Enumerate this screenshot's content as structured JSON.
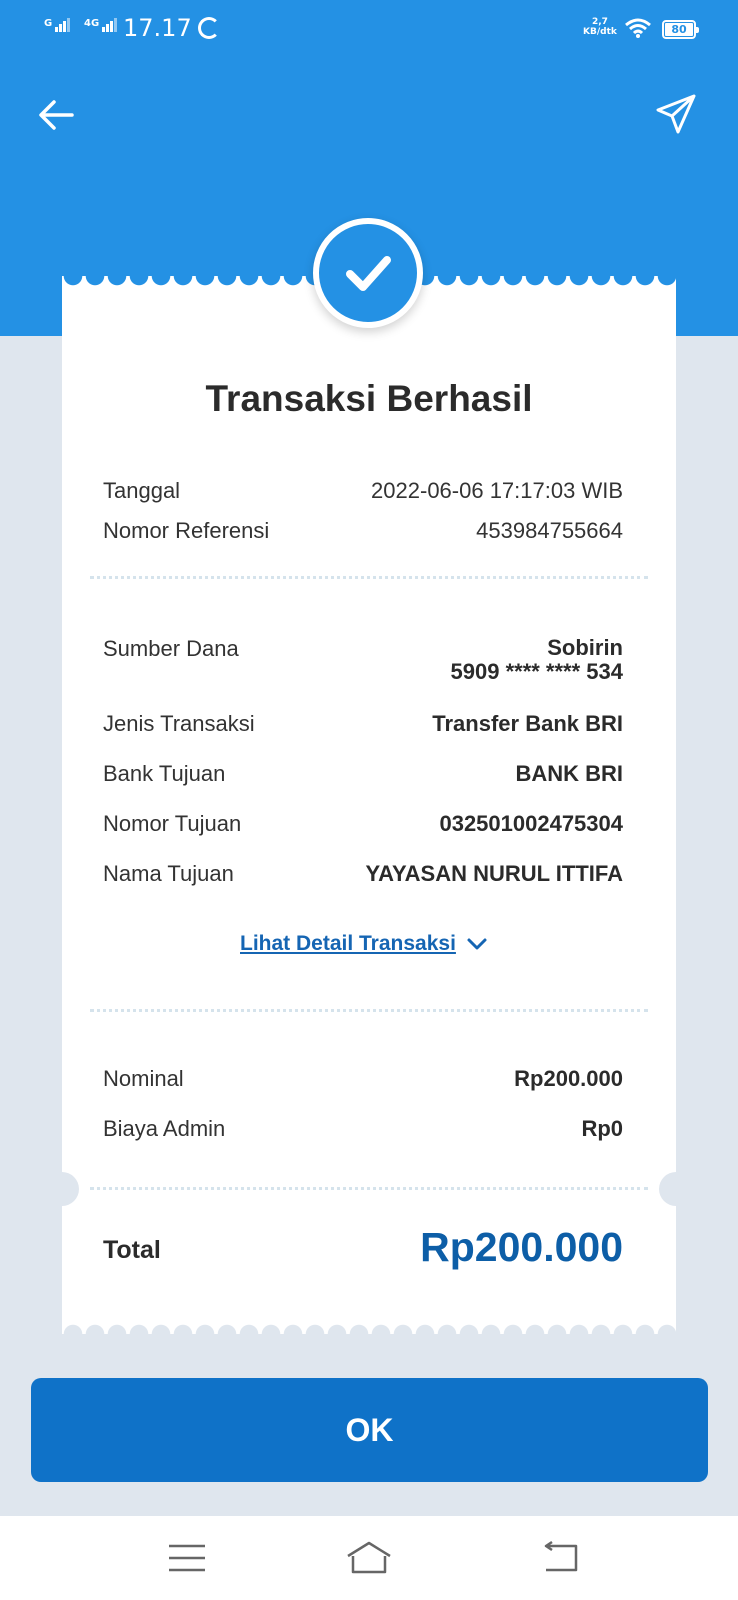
{
  "status_bar": {
    "sim1_label": "G",
    "sim2_label": "4G",
    "time": "17.17",
    "speed_value": "2,7",
    "speed_unit": "KB/dtk",
    "battery": "80"
  },
  "header": {
    "back_icon": "arrow-left-icon",
    "share_icon": "send-icon",
    "color": "#2491e4"
  },
  "receipt": {
    "title": "Transaksi Berhasil",
    "meta": [
      {
        "label": "Tanggal",
        "value": "2022-06-06 17:17:03 WIB"
      },
      {
        "label": "Nomor Referensi",
        "value": "453984755664"
      }
    ],
    "source": {
      "label": "Sumber Dana",
      "name": "Sobirin",
      "account": "5909 **** **** 534"
    },
    "details": [
      {
        "label": "Jenis Transaksi",
        "value": "Transfer Bank BRI"
      },
      {
        "label": "Bank Tujuan",
        "value": "BANK BRI"
      },
      {
        "label": "Nomor Tujuan",
        "value": "032501002475304"
      },
      {
        "label": "Nama Tujuan",
        "value": "YAYASAN NURUL ITTIFA"
      }
    ],
    "detail_link": "Lihat Detail Transaksi",
    "amounts": [
      {
        "label": "Nominal",
        "value": "Rp200.000"
      },
      {
        "label": "Biaya Admin",
        "value": "Rp0"
      }
    ],
    "total_label": "Total",
    "total_value": "Rp200.000"
  },
  "ok_button": "OK",
  "nav": {
    "menu_icon": "menu-icon",
    "home_icon": "home-icon",
    "back_icon": "back-icon"
  }
}
